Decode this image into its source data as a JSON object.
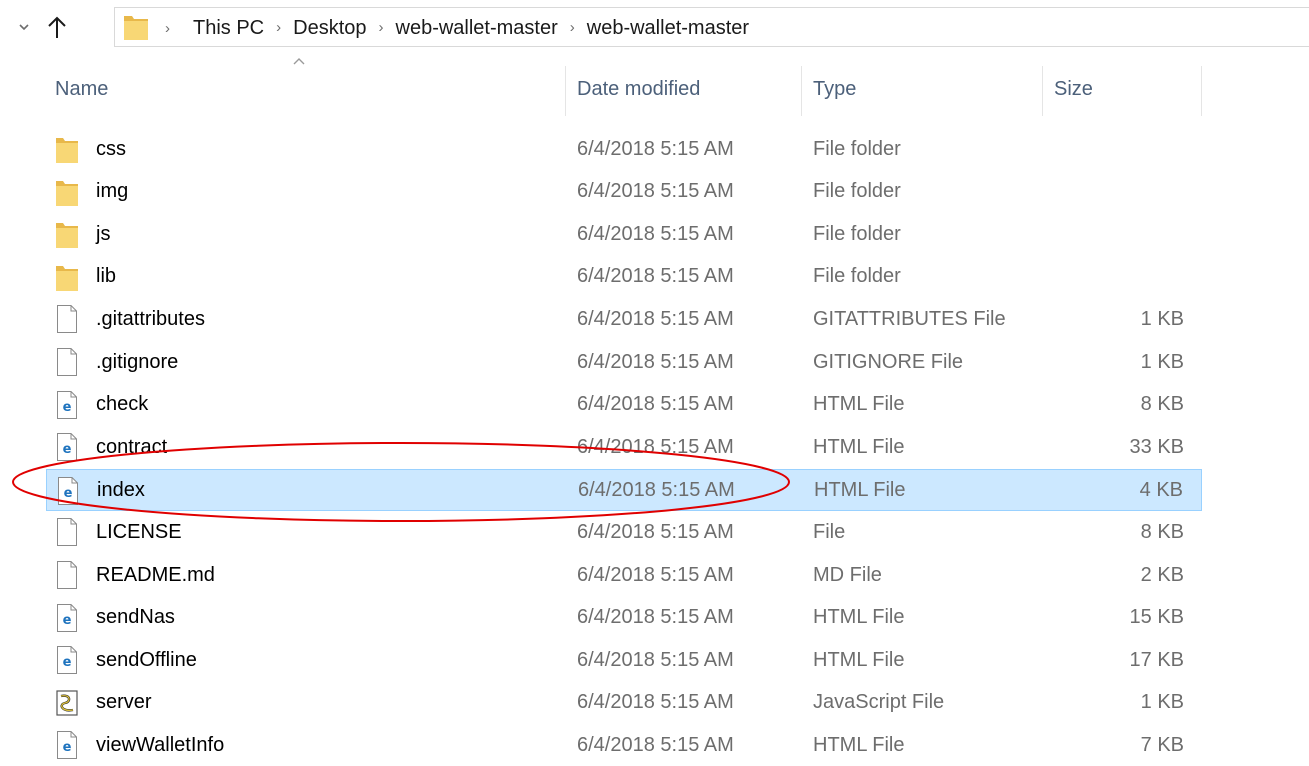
{
  "address_bar": {
    "breadcrumbs": [
      "This PC",
      "Desktop",
      "web-wallet-master",
      "web-wallet-master"
    ]
  },
  "columns": {
    "name": "Name",
    "date": "Date modified",
    "type": "Type",
    "size": "Size"
  },
  "files": [
    {
      "name": "css",
      "date": "6/4/2018 5:15 AM",
      "type": "File folder",
      "size": "",
      "icon": "folder-icon"
    },
    {
      "name": "img",
      "date": "6/4/2018 5:15 AM",
      "type": "File folder",
      "size": "",
      "icon": "folder-icon"
    },
    {
      "name": "js",
      "date": "6/4/2018 5:15 AM",
      "type": "File folder",
      "size": "",
      "icon": "folder-icon"
    },
    {
      "name": "lib",
      "date": "6/4/2018 5:15 AM",
      "type": "File folder",
      "size": "",
      "icon": "folder-icon"
    },
    {
      "name": ".gitattributes",
      "date": "6/4/2018 5:15 AM",
      "type": "GITATTRIBUTES File",
      "size": "1 KB",
      "icon": "file-icon"
    },
    {
      "name": ".gitignore",
      "date": "6/4/2018 5:15 AM",
      "type": "GITIGNORE File",
      "size": "1 KB",
      "icon": "file-icon"
    },
    {
      "name": "check",
      "date": "6/4/2018 5:15 AM",
      "type": "HTML File",
      "size": "8 KB",
      "icon": "html-file-icon"
    },
    {
      "name": "contract",
      "date": "6/4/2018 5:15 AM",
      "type": "HTML File",
      "size": "33 KB",
      "icon": "html-file-icon"
    },
    {
      "name": "index",
      "date": "6/4/2018 5:15 AM",
      "type": "HTML File",
      "size": "4 KB",
      "icon": "html-file-icon",
      "selected": true
    },
    {
      "name": "LICENSE",
      "date": "6/4/2018 5:15 AM",
      "type": "File",
      "size": "8 KB",
      "icon": "file-icon"
    },
    {
      "name": "README.md",
      "date": "6/4/2018 5:15 AM",
      "type": "MD File",
      "size": "2 KB",
      "icon": "file-icon"
    },
    {
      "name": "sendNas",
      "date": "6/4/2018 5:15 AM",
      "type": "HTML File",
      "size": "15 KB",
      "icon": "html-file-icon"
    },
    {
      "name": "sendOffline",
      "date": "6/4/2018 5:15 AM",
      "type": "HTML File",
      "size": "17 KB",
      "icon": "html-file-icon"
    },
    {
      "name": "server",
      "date": "6/4/2018 5:15 AM",
      "type": "JavaScript File",
      "size": "1 KB",
      "icon": "script-file-icon"
    },
    {
      "name": "viewWalletInfo",
      "date": "6/4/2018 5:15 AM",
      "type": "HTML File",
      "size": "7 KB",
      "icon": "html-file-icon"
    }
  ],
  "colors": {
    "selection_bg": "#cce8ff",
    "selection_border": "#99d1ff",
    "header_text": "#4c607a",
    "annotation": "#e00000",
    "folder": "#f8d775"
  }
}
